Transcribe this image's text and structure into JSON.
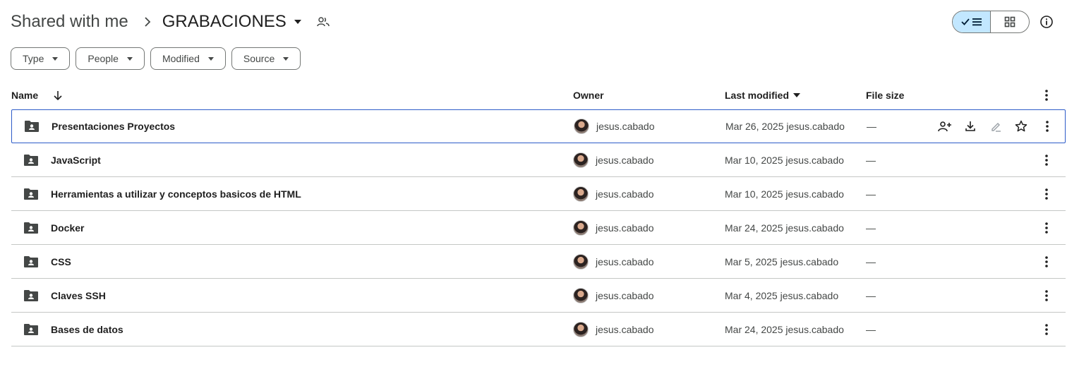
{
  "breadcrumb": {
    "root": "Shared with me",
    "separator": "›",
    "current": "GRABACIONES"
  },
  "filters": [
    "Type",
    "People",
    "Modified",
    "Source"
  ],
  "columns": {
    "name": "Name",
    "owner": "Owner",
    "modified": "Last modified",
    "size": "File size"
  },
  "rows": [
    {
      "name": "Presentaciones Proyectos",
      "owner": "jesus.cabado",
      "modified": "Mar 26, 2025 jesus.cabado",
      "size": "—",
      "selected": true
    },
    {
      "name": "JavaScript",
      "owner": "jesus.cabado",
      "modified": "Mar 10, 2025 jesus.cabado",
      "size": "—"
    },
    {
      "name": "Herramientas a utilizar y conceptos basicos de HTML",
      "owner": "jesus.cabado",
      "modified": "Mar 10, 2025 jesus.cabado",
      "size": "—"
    },
    {
      "name": "Docker",
      "owner": "jesus.cabado",
      "modified": "Mar 24, 2025 jesus.cabado",
      "size": "—"
    },
    {
      "name": "CSS",
      "owner": "jesus.cabado",
      "modified": "Mar 5, 2025 jesus.cabado",
      "size": "—"
    },
    {
      "name": "Claves SSH",
      "owner": "jesus.cabado",
      "modified": "Mar 4, 2025 jesus.cabado",
      "size": "—"
    },
    {
      "name": "Bases de datos",
      "owner": "jesus.cabado",
      "modified": "Mar 24, 2025 jesus.cabado",
      "size": "—"
    }
  ],
  "icons": {
    "folder": "shared-folder-icon",
    "row_actions": [
      "share-icon",
      "download-icon",
      "rename-icon",
      "star-icon"
    ],
    "more": "more-vert-icon",
    "view_list": "list-view-icon",
    "view_grid": "grid-view-icon",
    "info": "info-icon"
  },
  "colors": {
    "selected_border": "#2d5cc8",
    "toggle_active": "#c2e7ff"
  }
}
